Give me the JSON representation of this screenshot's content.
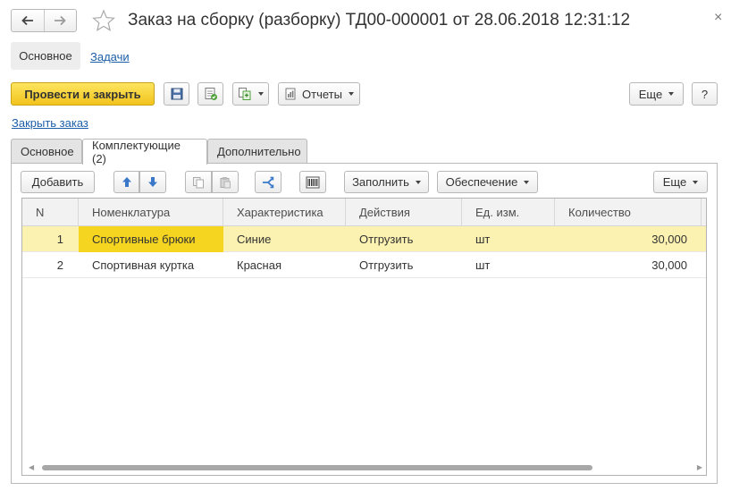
{
  "window": {
    "title": "Заказ на сборку (разборку) ТД00-000001 от 28.06.2018 12:31:12",
    "close_glyph": "×"
  },
  "nav": {
    "main_label": "Основное",
    "tasks_label": "Задачи"
  },
  "toolbar": {
    "post_close_label": "Провести и закрыть",
    "reports_label": "Отчеты",
    "more_label": "Еще",
    "help_label": "?"
  },
  "close_order_link": "Закрыть заказ",
  "tabs": [
    {
      "label": "Основное"
    },
    {
      "label": "Комплектующие (2)"
    },
    {
      "label": "Дополнительно"
    }
  ],
  "table_toolbar": {
    "add_label": "Добавить",
    "fill_label": "Заполнить",
    "provision_label": "Обеспечение",
    "more_label": "Еще"
  },
  "table": {
    "columns": [
      "N",
      "Номенклатура",
      "Характеристика",
      "Действия",
      "Ед. изм.",
      "Количество"
    ],
    "rows": [
      {
        "n": "1",
        "item": "Спортивные брюки",
        "characteristic": "Синие",
        "action": "Отгрузить",
        "unit": "шт",
        "qty": "30,000"
      },
      {
        "n": "2",
        "item": "Спортивная куртка",
        "characteristic": "Красная",
        "action": "Отгрузить",
        "unit": "шт",
        "qty": "30,000"
      }
    ]
  },
  "colors": {
    "accent_yellow": "#f2c31c",
    "selected_row": "#fbf1b0",
    "current_cell": "#f5d51f",
    "link_blue": "#1c5ea8"
  }
}
